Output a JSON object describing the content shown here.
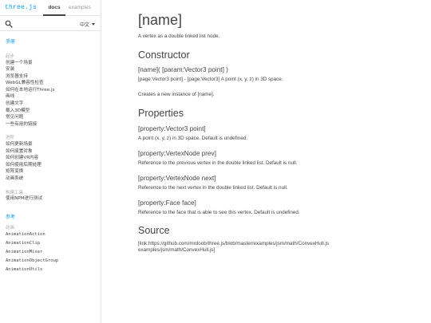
{
  "header": {
    "brand": "three.js",
    "tabs": [
      {
        "label": "docs",
        "active": true
      },
      {
        "label": "examples",
        "active": false
      }
    ],
    "search_icon": "search-icon",
    "language": "中文"
  },
  "sidebar": {
    "manual_title": "手册",
    "groups": [
      {
        "title": "起步",
        "items": [
          "创建一个场景",
          "安装",
          "浏览器支持",
          "WebGL兼容性检查",
          "如何在本地运行Three.js",
          "画线",
          "创建文字",
          "载入3D模型",
          "常见问题",
          "一些有用的链接"
        ]
      },
      {
        "title": "进阶",
        "items": [
          "如何更新场景",
          "如何废置对象",
          "如何创建VR内容",
          "如何使用后期处理",
          "矩阵变换",
          "动画系统"
        ]
      },
      {
        "title": "构建工具",
        "items": [
          "使用NPM进行测试"
        ]
      }
    ],
    "reference_title": "参考",
    "reference_groups": [
      {
        "title": "动画",
        "items": [
          "AnimationAction",
          "AnimationClip",
          "AnimationMixer",
          "AnimationObjectGroup",
          "AnimationUtils"
        ]
      }
    ]
  },
  "main": {
    "title": "[name]",
    "description": "A vertex as a double linked list node.",
    "constructor_heading": "Constructor",
    "constructor_sig": "[name]( [param:Vector3 point] )",
    "constructor_param": "[page:Vector3 point] - [page:Vector3] A point (x, y, z) in 3D space.",
    "constructor_desc": "Creates a new instance of [name].",
    "properties_heading": "Properties",
    "properties": [
      {
        "name": "[property:Vector3 point]",
        "desc": "A point (x, y, z) in 3D space. Default is undefined."
      },
      {
        "name": "[property:VertexNode prev]",
        "desc": "Reference to the previous vertex in the double linked list. Default is null."
      },
      {
        "name": "[property:VertexNode next]",
        "desc": "Reference to the next vertex in the double linked list. Default is null."
      },
      {
        "name": "[property:Face face]",
        "desc": "Reference to the face that is able to see this vertex. Default is undefined."
      }
    ],
    "source_heading": "Source",
    "source_line1": "[link:https://github.com/mrdoob/three.js/blob/master/examples/jsm/math/ConvexHull.js",
    "source_line2": "examples/jsm/math/ConvexHull.js]"
  },
  "colors": {
    "accent": "#049EF4",
    "text": "#444444",
    "muted": "#AAAAAA",
    "border": "#E4E4E4"
  }
}
